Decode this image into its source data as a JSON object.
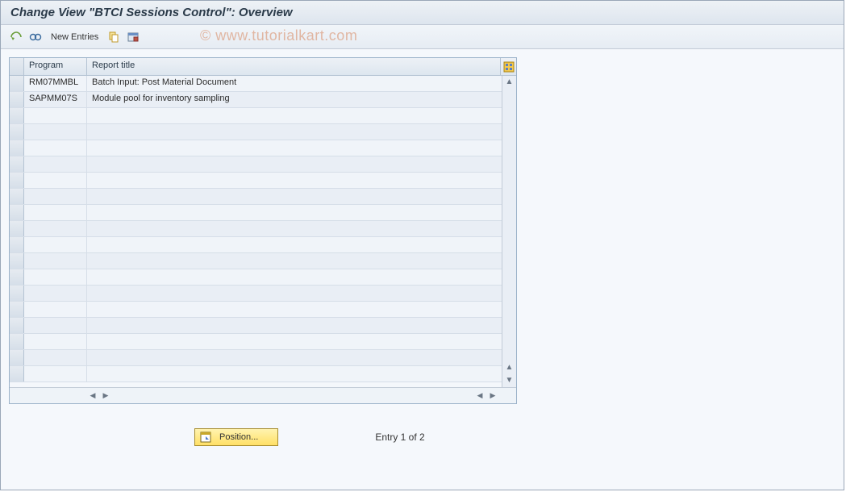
{
  "title": "Change View \"BTCI Sessions Control\": Overview",
  "toolbar": {
    "expand_other_icon": "expand-other-view",
    "glasses_icon": "display-change",
    "new_entries_label": "New Entries",
    "copy_icon": "copy",
    "delimit_icon": "delimit"
  },
  "table": {
    "columns": {
      "program": "Program",
      "report_title": "Report title"
    },
    "rows": [
      {
        "program": "RM07MMBL",
        "title": "Batch Input: Post Material Document"
      },
      {
        "program": "SAPMM07S",
        "title": "Module pool for inventory sampling"
      }
    ],
    "config_icon": "table-settings"
  },
  "position_button": {
    "label": "Position...",
    "icon": "position-marker"
  },
  "entry_status": "Entry 1 of 2",
  "watermark": "© www.tutorialkart.com"
}
